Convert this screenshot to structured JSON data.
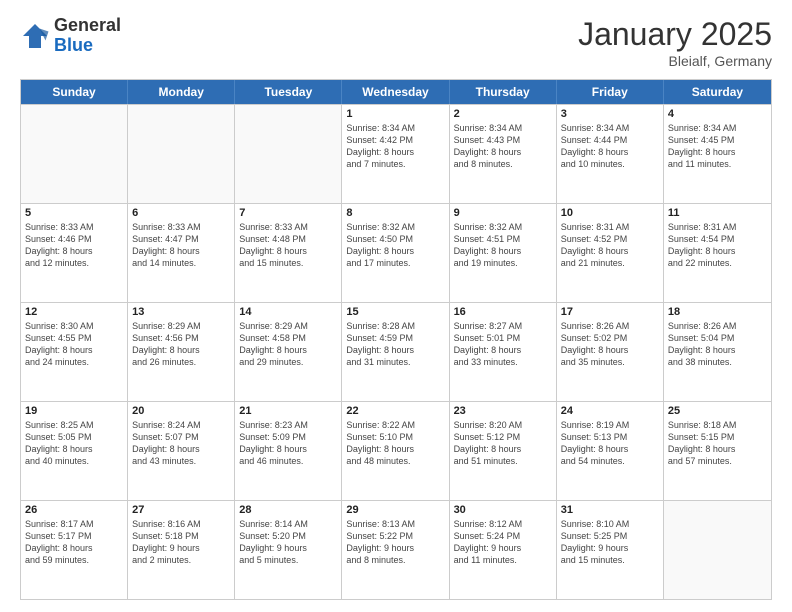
{
  "header": {
    "logo_general": "General",
    "logo_blue": "Blue",
    "month_title": "January 2025",
    "location": "Bleialf, Germany"
  },
  "weekdays": [
    "Sunday",
    "Monday",
    "Tuesday",
    "Wednesday",
    "Thursday",
    "Friday",
    "Saturday"
  ],
  "rows": [
    [
      {
        "day": "",
        "lines": []
      },
      {
        "day": "",
        "lines": []
      },
      {
        "day": "",
        "lines": []
      },
      {
        "day": "1",
        "lines": [
          "Sunrise: 8:34 AM",
          "Sunset: 4:42 PM",
          "Daylight: 8 hours",
          "and 7 minutes."
        ]
      },
      {
        "day": "2",
        "lines": [
          "Sunrise: 8:34 AM",
          "Sunset: 4:43 PM",
          "Daylight: 8 hours",
          "and 8 minutes."
        ]
      },
      {
        "day": "3",
        "lines": [
          "Sunrise: 8:34 AM",
          "Sunset: 4:44 PM",
          "Daylight: 8 hours",
          "and 10 minutes."
        ]
      },
      {
        "day": "4",
        "lines": [
          "Sunrise: 8:34 AM",
          "Sunset: 4:45 PM",
          "Daylight: 8 hours",
          "and 11 minutes."
        ]
      }
    ],
    [
      {
        "day": "5",
        "lines": [
          "Sunrise: 8:33 AM",
          "Sunset: 4:46 PM",
          "Daylight: 8 hours",
          "and 12 minutes."
        ]
      },
      {
        "day": "6",
        "lines": [
          "Sunrise: 8:33 AM",
          "Sunset: 4:47 PM",
          "Daylight: 8 hours",
          "and 14 minutes."
        ]
      },
      {
        "day": "7",
        "lines": [
          "Sunrise: 8:33 AM",
          "Sunset: 4:48 PM",
          "Daylight: 8 hours",
          "and 15 minutes."
        ]
      },
      {
        "day": "8",
        "lines": [
          "Sunrise: 8:32 AM",
          "Sunset: 4:50 PM",
          "Daylight: 8 hours",
          "and 17 minutes."
        ]
      },
      {
        "day": "9",
        "lines": [
          "Sunrise: 8:32 AM",
          "Sunset: 4:51 PM",
          "Daylight: 8 hours",
          "and 19 minutes."
        ]
      },
      {
        "day": "10",
        "lines": [
          "Sunrise: 8:31 AM",
          "Sunset: 4:52 PM",
          "Daylight: 8 hours",
          "and 21 minutes."
        ]
      },
      {
        "day": "11",
        "lines": [
          "Sunrise: 8:31 AM",
          "Sunset: 4:54 PM",
          "Daylight: 8 hours",
          "and 22 minutes."
        ]
      }
    ],
    [
      {
        "day": "12",
        "lines": [
          "Sunrise: 8:30 AM",
          "Sunset: 4:55 PM",
          "Daylight: 8 hours",
          "and 24 minutes."
        ]
      },
      {
        "day": "13",
        "lines": [
          "Sunrise: 8:29 AM",
          "Sunset: 4:56 PM",
          "Daylight: 8 hours",
          "and 26 minutes."
        ]
      },
      {
        "day": "14",
        "lines": [
          "Sunrise: 8:29 AM",
          "Sunset: 4:58 PM",
          "Daylight: 8 hours",
          "and 29 minutes."
        ]
      },
      {
        "day": "15",
        "lines": [
          "Sunrise: 8:28 AM",
          "Sunset: 4:59 PM",
          "Daylight: 8 hours",
          "and 31 minutes."
        ]
      },
      {
        "day": "16",
        "lines": [
          "Sunrise: 8:27 AM",
          "Sunset: 5:01 PM",
          "Daylight: 8 hours",
          "and 33 minutes."
        ]
      },
      {
        "day": "17",
        "lines": [
          "Sunrise: 8:26 AM",
          "Sunset: 5:02 PM",
          "Daylight: 8 hours",
          "and 35 minutes."
        ]
      },
      {
        "day": "18",
        "lines": [
          "Sunrise: 8:26 AM",
          "Sunset: 5:04 PM",
          "Daylight: 8 hours",
          "and 38 minutes."
        ]
      }
    ],
    [
      {
        "day": "19",
        "lines": [
          "Sunrise: 8:25 AM",
          "Sunset: 5:05 PM",
          "Daylight: 8 hours",
          "and 40 minutes."
        ]
      },
      {
        "day": "20",
        "lines": [
          "Sunrise: 8:24 AM",
          "Sunset: 5:07 PM",
          "Daylight: 8 hours",
          "and 43 minutes."
        ]
      },
      {
        "day": "21",
        "lines": [
          "Sunrise: 8:23 AM",
          "Sunset: 5:09 PM",
          "Daylight: 8 hours",
          "and 46 minutes."
        ]
      },
      {
        "day": "22",
        "lines": [
          "Sunrise: 8:22 AM",
          "Sunset: 5:10 PM",
          "Daylight: 8 hours",
          "and 48 minutes."
        ]
      },
      {
        "day": "23",
        "lines": [
          "Sunrise: 8:20 AM",
          "Sunset: 5:12 PM",
          "Daylight: 8 hours",
          "and 51 minutes."
        ]
      },
      {
        "day": "24",
        "lines": [
          "Sunrise: 8:19 AM",
          "Sunset: 5:13 PM",
          "Daylight: 8 hours",
          "and 54 minutes."
        ]
      },
      {
        "day": "25",
        "lines": [
          "Sunrise: 8:18 AM",
          "Sunset: 5:15 PM",
          "Daylight: 8 hours",
          "and 57 minutes."
        ]
      }
    ],
    [
      {
        "day": "26",
        "lines": [
          "Sunrise: 8:17 AM",
          "Sunset: 5:17 PM",
          "Daylight: 8 hours",
          "and 59 minutes."
        ]
      },
      {
        "day": "27",
        "lines": [
          "Sunrise: 8:16 AM",
          "Sunset: 5:18 PM",
          "Daylight: 9 hours",
          "and 2 minutes."
        ]
      },
      {
        "day": "28",
        "lines": [
          "Sunrise: 8:14 AM",
          "Sunset: 5:20 PM",
          "Daylight: 9 hours",
          "and 5 minutes."
        ]
      },
      {
        "day": "29",
        "lines": [
          "Sunrise: 8:13 AM",
          "Sunset: 5:22 PM",
          "Daylight: 9 hours",
          "and 8 minutes."
        ]
      },
      {
        "day": "30",
        "lines": [
          "Sunrise: 8:12 AM",
          "Sunset: 5:24 PM",
          "Daylight: 9 hours",
          "and 11 minutes."
        ]
      },
      {
        "day": "31",
        "lines": [
          "Sunrise: 8:10 AM",
          "Sunset: 5:25 PM",
          "Daylight: 9 hours",
          "and 15 minutes."
        ]
      },
      {
        "day": "",
        "lines": []
      }
    ]
  ]
}
